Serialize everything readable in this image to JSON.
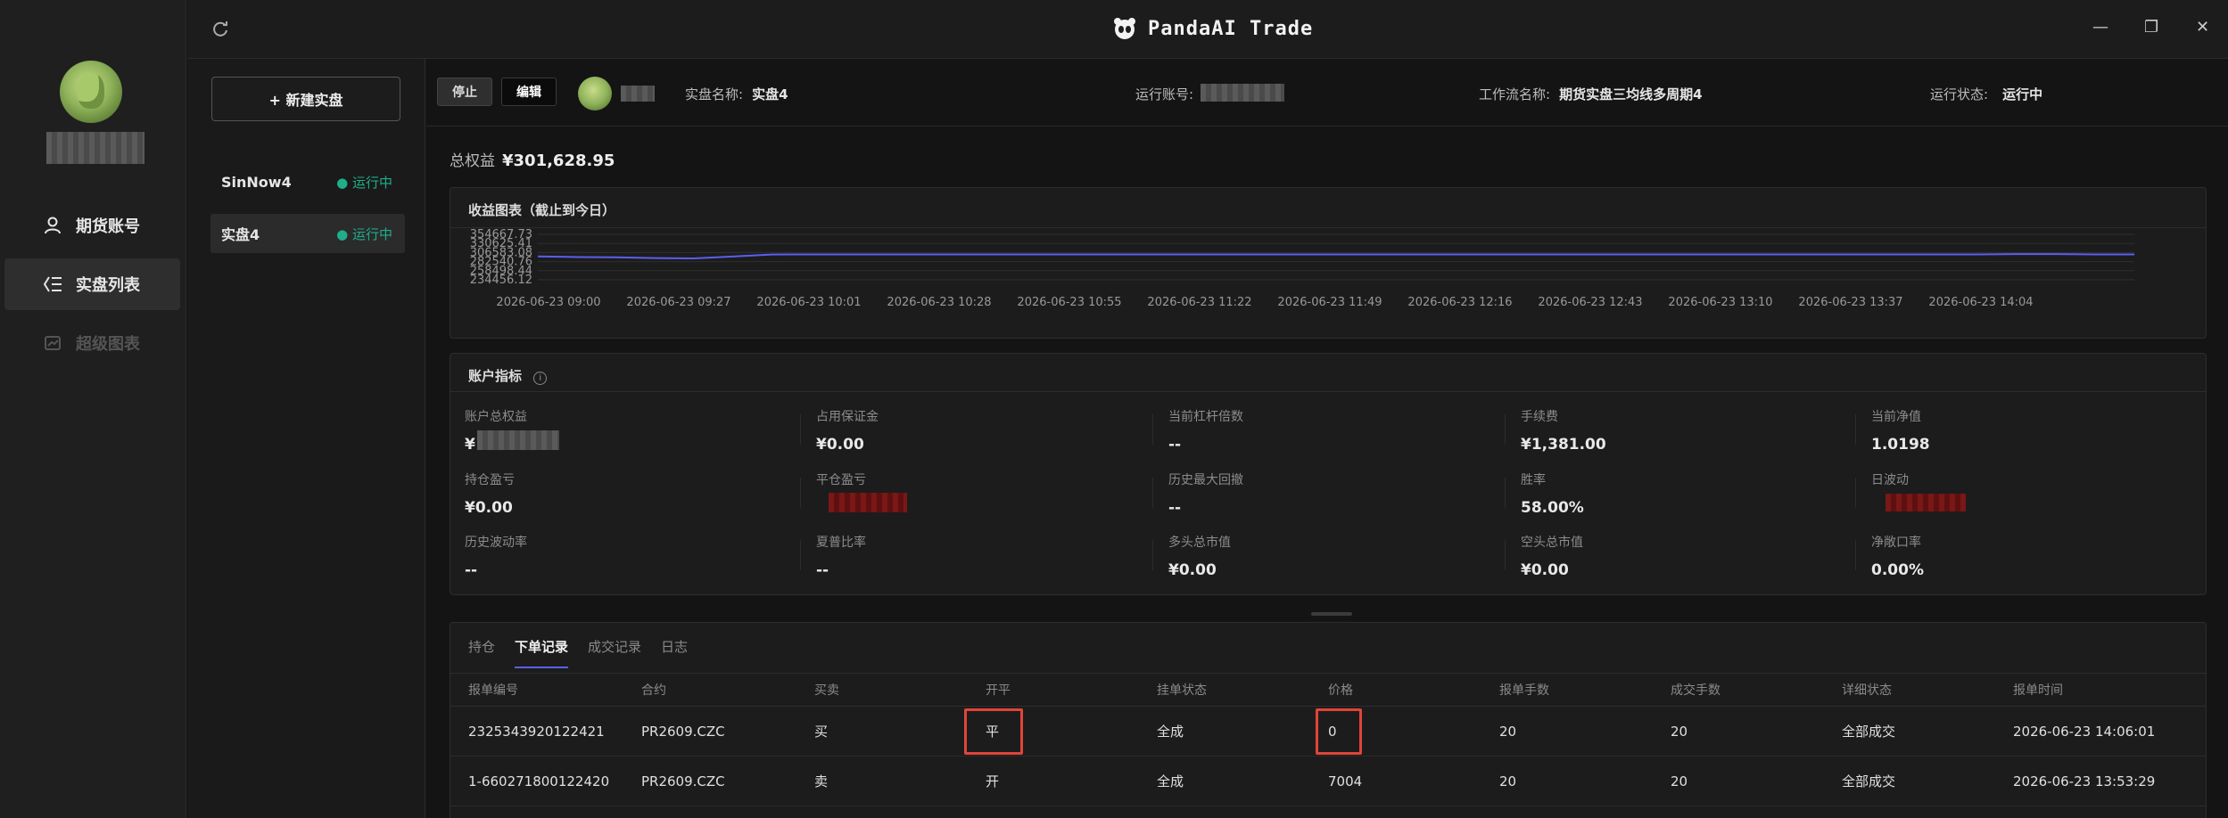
{
  "app": {
    "title": "PandaAI Trade"
  },
  "nav": {
    "items": [
      {
        "label": "期货账号",
        "icon": "user-icon"
      },
      {
        "label": "实盘列表",
        "icon": "list-icon"
      },
      {
        "label": "超级图表",
        "icon": "chart-icon"
      }
    ]
  },
  "strategy_list": {
    "new_button": "+ 新建实盘",
    "items": [
      {
        "name": "SinNow4",
        "status": "● 运行中"
      },
      {
        "name": "实盘4",
        "status": "● 运行中"
      }
    ]
  },
  "infobar": {
    "stop": "停止",
    "edit": "编辑",
    "name_label": "实盘名称:",
    "name_value": "实盘4",
    "account_label": "运行账号:",
    "workflow_label": "工作流名称:",
    "workflow_value": "期货实盘三均线多周期4",
    "status_label": "运行状态:",
    "status_value": "运行中"
  },
  "equity": {
    "label": "总权益",
    "value": "¥301,628.95"
  },
  "chart_card": {
    "title": "收益图表（截止到今日）"
  },
  "chart_data": {
    "type": "line",
    "y_ticks": [
      "354667.73",
      "330625.41",
      "306583.08",
      "282540.76",
      "258498.44",
      "234456.12"
    ],
    "ylim": [
      234456.12,
      354667.73
    ],
    "x_ticks": [
      "2026-06-23 09:00",
      "2026-06-23 09:27",
      "2026-06-23 10:01",
      "2026-06-23 10:28",
      "2026-06-23 10:55",
      "2026-06-23 11:22",
      "2026-06-23 11:49",
      "2026-06-23 12:16",
      "2026-06-23 12:43",
      "2026-06-23 13:10",
      "2026-06-23 13:37",
      "2026-06-23 14:04"
    ],
    "series": [
      {
        "color": "#5b5ff0",
        "values": [
          296500,
          294500,
          294200,
          292000,
          291000,
          296000,
          301500,
          301628,
          301628,
          301628,
          301628,
          301628,
          301628,
          301628,
          301628,
          301628,
          301628,
          301628,
          301628,
          301628,
          301628,
          301628,
          301628,
          301628,
          301628,
          301628,
          301628,
          301628,
          301628,
          301628,
          301628,
          301628,
          301628,
          301628,
          301628,
          301628,
          301628,
          301628,
          302600,
          302600,
          301628,
          301628
        ]
      }
    ]
  },
  "metrics": {
    "title": "账户指标",
    "items": [
      {
        "label": "账户总权益",
        "value": "¥"
      },
      {
        "label": "占用保证金",
        "value": "¥0.00"
      },
      {
        "label": "当前杠杆倍数",
        "value": "--"
      },
      {
        "label": "手续费",
        "value": "¥1,381.00"
      },
      {
        "label": "当前净值",
        "value": "1.0198"
      },
      {
        "label": "持仓盈亏",
        "value": "¥0.00"
      },
      {
        "label": "平仓盈亏",
        "value": ""
      },
      {
        "label": "历史最大回撤",
        "value": "--"
      },
      {
        "label": "胜率",
        "value": "58.00%"
      },
      {
        "label": "日波动",
        "value": ""
      },
      {
        "label": "历史波动率",
        "value": "--"
      },
      {
        "label": "夏普比率",
        "value": "--"
      },
      {
        "label": "多头总市值",
        "value": "¥0.00"
      },
      {
        "label": "空头总市值",
        "value": "¥0.00"
      },
      {
        "label": "净敞口率",
        "value": "0.00%"
      }
    ]
  },
  "orders": {
    "tabs": [
      "持仓",
      "下单记录",
      "成交记录",
      "日志"
    ],
    "active_tab": 1,
    "columns": [
      "报单编号",
      "合约",
      "买卖",
      "开平",
      "挂单状态",
      "价格",
      "报单手数",
      "成交手数",
      "详细状态",
      "报单时间"
    ],
    "rows": [
      [
        "2325343920122421",
        "PR2609.CZC",
        "买",
        "平",
        "全成",
        "0",
        "20",
        "20",
        "全部成交",
        "2026-06-23 14:06:01"
      ],
      [
        "1-660271800122420",
        "PR2609.CZC",
        "卖",
        "开",
        "全成",
        "7004",
        "20",
        "20",
        "全部成交",
        "2026-06-23 13:53:29"
      ]
    ]
  }
}
